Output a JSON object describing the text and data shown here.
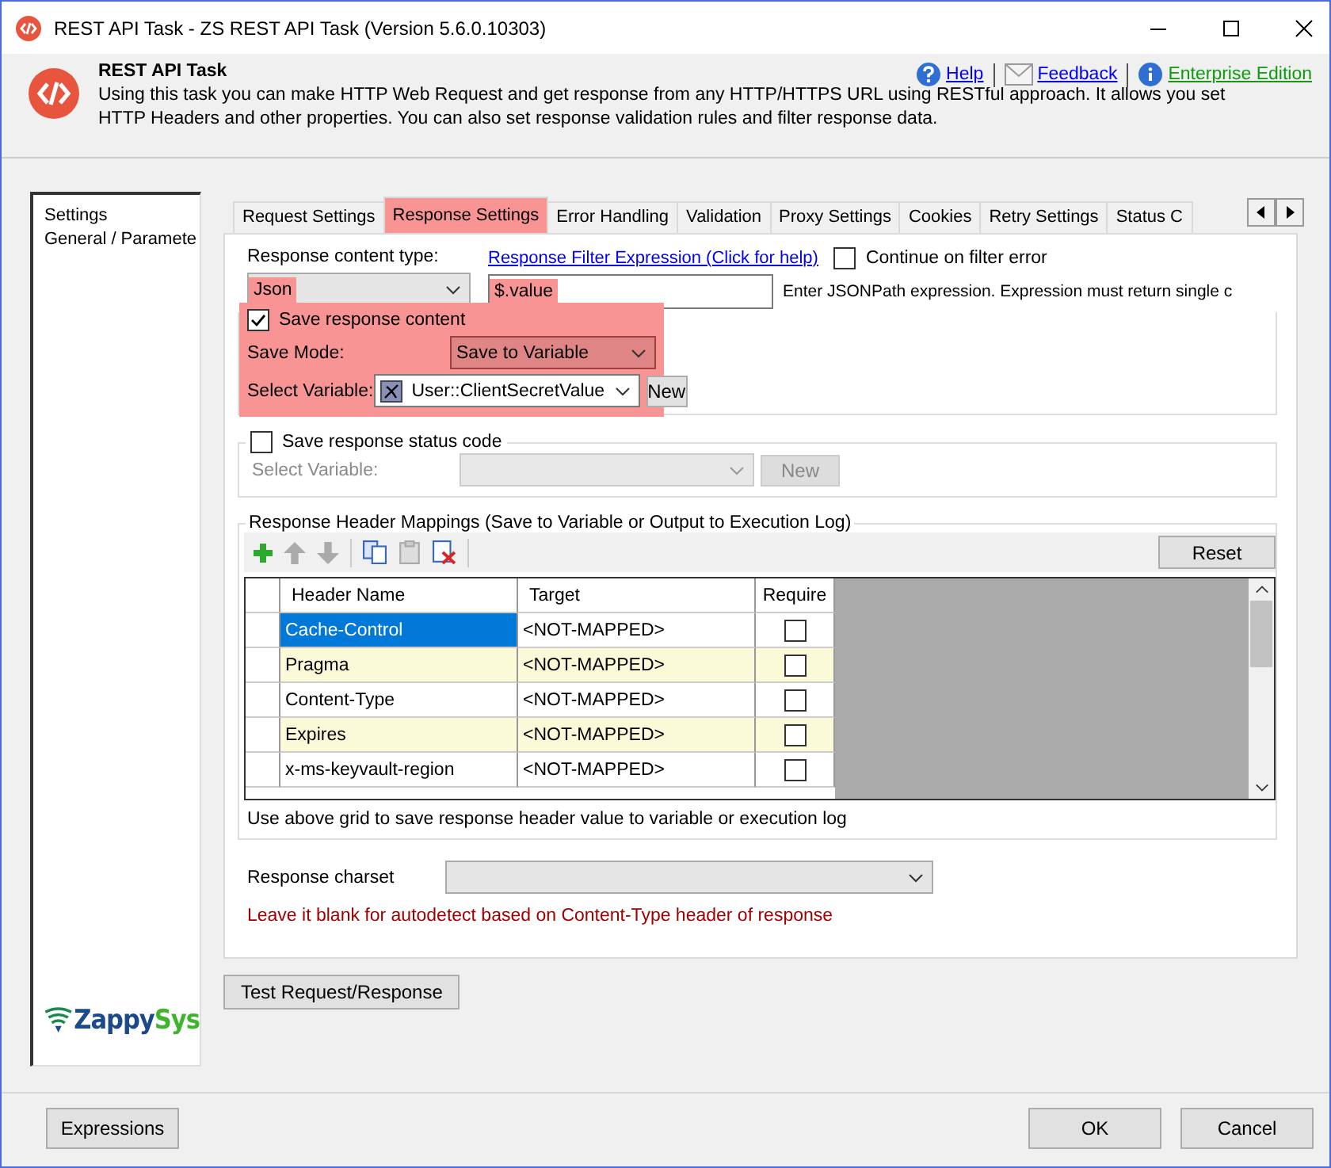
{
  "window": {
    "title": "REST API Task - ZS REST API Task (Version 5.6.0.10303)"
  },
  "header": {
    "title": "REST API Task",
    "description": "Using this task you can make HTTP Web Request and get response from any HTTP/HTTPS URL using RESTful approach. It allows you set HTTP Headers and other properties. You can also set response validation rules and filter response data.",
    "links": [
      {
        "label": "Help",
        "kind": "help"
      },
      {
        "label": "Feedback",
        "kind": "mail"
      },
      {
        "label": "Enterprise Edition",
        "kind": "info"
      }
    ]
  },
  "sidebar": {
    "items": [
      {
        "label": "Settings"
      },
      {
        "label": "General / Paramete"
      }
    ],
    "logo": {
      "first": "Zappy",
      "second": "Sys"
    }
  },
  "tabs": [
    {
      "label": "Request Settings",
      "selected": false,
      "highlighted": false
    },
    {
      "label": "Response Settings",
      "selected": true,
      "highlighted": true
    },
    {
      "label": "Error Handling",
      "selected": false,
      "highlighted": false
    },
    {
      "label": "Validation",
      "selected": false,
      "highlighted": false
    },
    {
      "label": "Proxy Settings",
      "selected": false,
      "highlighted": false
    },
    {
      "label": "Cookies",
      "selected": false,
      "highlighted": false
    },
    {
      "label": "Retry Settings",
      "selected": false,
      "highlighted": false
    },
    {
      "label": "Status C",
      "selected": false,
      "highlighted": false
    }
  ],
  "content_type": {
    "label": "Response content type:",
    "value": "Json",
    "highlighted": true
  },
  "filter": {
    "link": "Response Filter Expression (Click for help)",
    "value": "$.value",
    "highlighted": true,
    "hint": "Enter JSONPath expression. Expression must return single c"
  },
  "continue_on_error": {
    "label": "Continue on filter error",
    "checked": false
  },
  "save_content": {
    "label": "Save response content",
    "checked": true,
    "highlighted": true,
    "mode_label": "Save Mode:",
    "mode_value": "Save to Variable",
    "variable_label": "Select Variable:",
    "variable_value": "User::ClientSecretValue",
    "new_button": "New"
  },
  "status_code": {
    "label": "Save response status code",
    "checked": false,
    "variable_label": "Select Variable:",
    "new_button": "New",
    "disabled": true
  },
  "header_mappings": {
    "title": "Response Header Mappings (Save to Variable or Output to Execution Log)",
    "reset_button": "Reset",
    "columns": [
      "Header Name",
      "Target",
      "Require"
    ],
    "rows": [
      {
        "header_name": "Cache-Control",
        "target": "<NOT-MAPPED>",
        "required": false,
        "selected": true
      },
      {
        "header_name": "Pragma",
        "target": "<NOT-MAPPED>",
        "required": false,
        "selected": false
      },
      {
        "header_name": "Content-Type",
        "target": "<NOT-MAPPED>",
        "required": false,
        "selected": false
      },
      {
        "header_name": "Expires",
        "target": "<NOT-MAPPED>",
        "required": false,
        "selected": false
      },
      {
        "header_name": "x-ms-keyvault-region",
        "target": "<NOT-MAPPED>",
        "required": false,
        "selected": false
      }
    ],
    "note": "Use above grid to save response header value to variable or execution log"
  },
  "charset": {
    "label": "Response charset",
    "note": "Leave it blank for autodetect based on Content-Type header of response"
  },
  "test_button": "Test Request/Response",
  "buttons": {
    "left": "Expressions",
    "ok": "OK",
    "cancel": "Cancel"
  }
}
